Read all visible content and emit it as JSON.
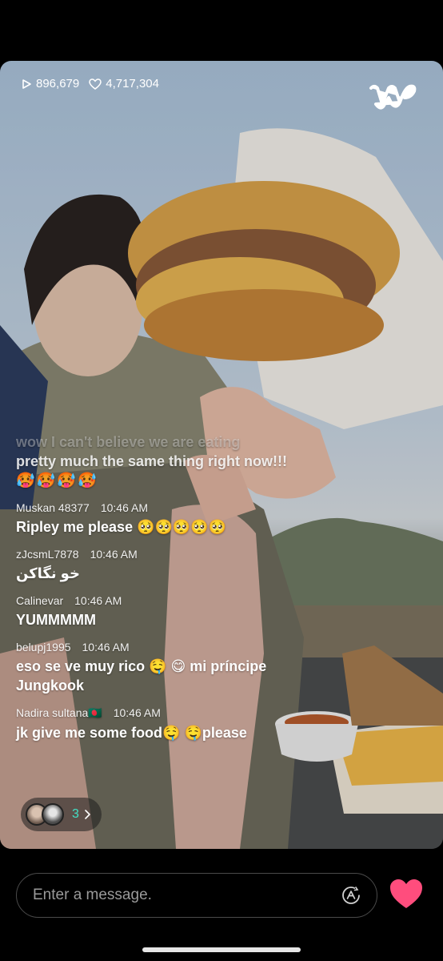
{
  "stats": {
    "plays": "896,679",
    "likes": "4,717,304"
  },
  "brand": {
    "logo_icon": "weverse-w-logo"
  },
  "chat": {
    "faded_line": "wow I can't believe we are eating",
    "pinned_line": "pretty much the same thing right now!!!",
    "pinned_emoji": "🥵🥵🥵🥵",
    "messages": [
      {
        "user": "Muskan 48377",
        "time": "10:46 AM",
        "text": "Ripley me please 🥺🥺🥺🥺🥺"
      },
      {
        "user": "zJcsmL7878",
        "time": "10:46 AM",
        "text": "خو نگاکن"
      },
      {
        "user": "Calinevar",
        "time": "10:46 AM",
        "text": "YUMMMMM"
      },
      {
        "user": "belupj1995",
        "time": "10:46 AM",
        "text": "eso se ve muy rico 🤤 😋  mi príncipe Jungkook"
      },
      {
        "user": "Nadira sultana🇧🇩",
        "time": "10:46 AM",
        "text": "jk give me some food🤤 🤤please"
      }
    ]
  },
  "viewers": {
    "count": "3"
  },
  "composer": {
    "placeholder": "Enter a message."
  },
  "colors": {
    "accent_count": "#42e0c5",
    "heart": "#ff4d7d"
  }
}
